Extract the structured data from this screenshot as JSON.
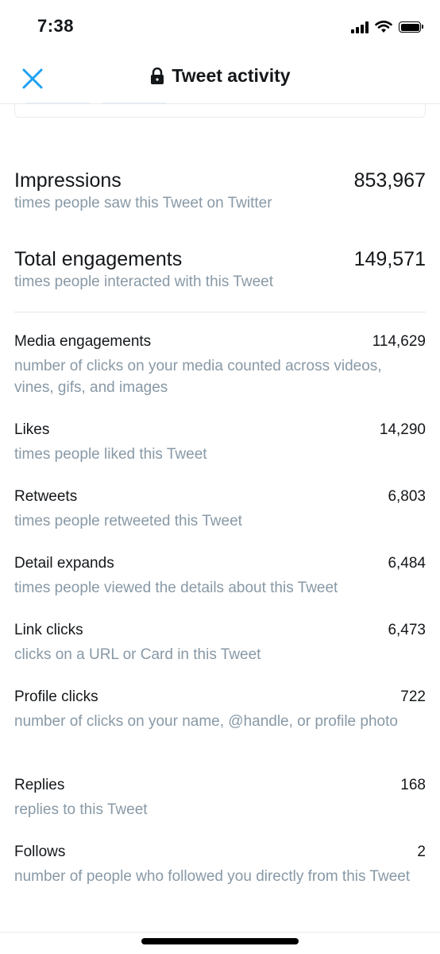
{
  "status_bar": {
    "time": "7:38",
    "icons": [
      "signal-icon",
      "wifi-icon",
      "battery-icon"
    ]
  },
  "nav": {
    "title": "Tweet activity",
    "close_icon": "close-icon",
    "lock_icon": "lock-icon",
    "accent_color": "#1da1f2"
  },
  "summary": [
    {
      "label": "Impressions",
      "value": "853,967",
      "desc": "times people saw this Tweet on Twitter"
    },
    {
      "label": "Total engagements",
      "value": "149,571",
      "desc": "times people interacted with this Tweet"
    }
  ],
  "metrics": [
    {
      "label": "Media engagements",
      "value": "114,629",
      "desc": "number of clicks on your media counted across videos, vines, gifs, and images"
    },
    {
      "label": "Likes",
      "value": "14,290",
      "desc": "times people liked this Tweet"
    },
    {
      "label": "Retweets",
      "value": "6,803",
      "desc": "times people retweeted this Tweet"
    },
    {
      "label": "Detail expands",
      "value": "6,484",
      "desc": "times people viewed the details about this Tweet"
    },
    {
      "label": "Link clicks",
      "value": "6,473",
      "desc": "clicks on a URL or Card in this Tweet"
    },
    {
      "label": "Profile clicks",
      "value": "722",
      "desc": "number of clicks on your name, @handle, or profile photo"
    },
    {
      "label": "Replies",
      "value": "168",
      "desc": "replies to this Tweet"
    },
    {
      "label": "Follows",
      "value": "2",
      "desc": "number of people who followed you directly from this Tweet"
    }
  ]
}
